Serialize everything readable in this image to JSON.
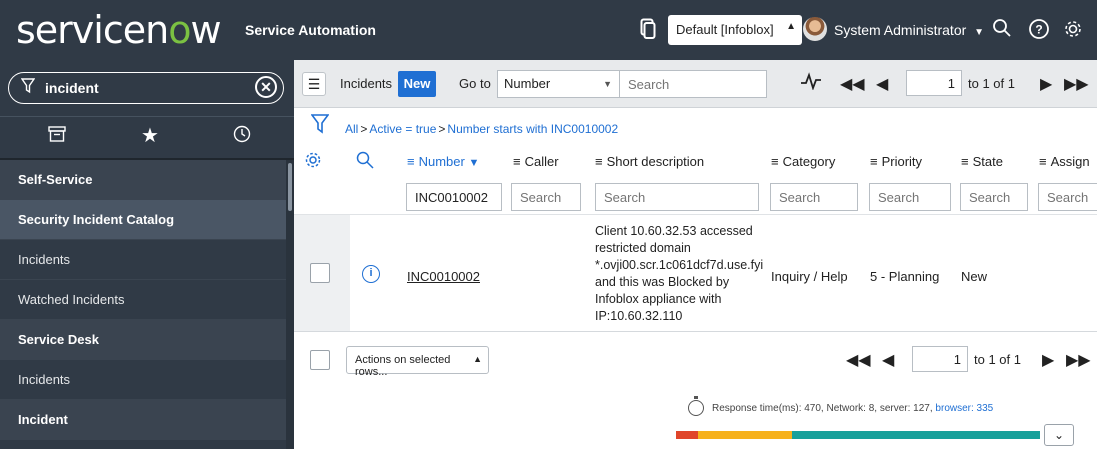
{
  "header": {
    "logo_part1": "servicen",
    "logo_part2": "o",
    "logo_part3": "w",
    "app_name": "Service Automation",
    "domain_value": "Default [Infoblox]",
    "username": "System Administrator",
    "icons": [
      "connect-icon",
      "search-icon",
      "help-icon",
      "gear-icon"
    ]
  },
  "nav": {
    "filter_value": "incident",
    "tabs": [
      "all-apps-icon",
      "favorites-star-icon",
      "history-clock-icon"
    ],
    "items": [
      {
        "label": "Self-Service",
        "kind": "section"
      },
      {
        "label": "Security Incident Catalog",
        "kind": "active"
      },
      {
        "label": "Incidents",
        "kind": "item"
      },
      {
        "label": "Watched Incidents",
        "kind": "item"
      },
      {
        "label": "Service Desk",
        "kind": "section"
      },
      {
        "label": "Incidents",
        "kind": "item"
      },
      {
        "label": "Incident",
        "kind": "section"
      }
    ]
  },
  "list": {
    "title": "Incidents",
    "new_label": "New",
    "goto_label": "Go to",
    "field_value": "Number",
    "search_placeholder": "Search",
    "page_value": "1",
    "page_text": "to 1 of 1"
  },
  "breadcrumb": [
    "All",
    "Active = true",
    "Number starts with INC0010002"
  ],
  "columns": [
    "Number",
    "Caller",
    "Short description",
    "Category",
    "Priority",
    "State",
    "Assign"
  ],
  "column_search": {
    "number": "INC0010002",
    "placeholder": "Search"
  },
  "rows": [
    {
      "number": "INC0010002",
      "caller": "",
      "short_description": "Client 10.60.32.53 accessed restricted domain *.ovji00.scr.1c061dcf7d.use.fyi and this was Blocked by Infoblox appliance with IP:10.60.32.110",
      "category": "Inquiry / Help",
      "priority": "5 - Planning",
      "state": "New"
    }
  ],
  "footer": {
    "actions_label": "Actions on selected rows...",
    "page_value": "1",
    "page_text": "to 1 of 1"
  },
  "response": {
    "text": "Response time(ms): 470, Network: 8, server: 127,",
    "browser_link": "browser: 335",
    "segments": [
      {
        "name": "network",
        "value": 8,
        "color": "#e0452a"
      },
      {
        "name": "server",
        "value": 127,
        "color": "#f6b11c"
      },
      {
        "name": "browser",
        "value": 335,
        "color": "#17a09a"
      }
    ]
  },
  "colors": {
    "header_bg": "#303a46",
    "accent": "#1f6fd3",
    "logo_accent": "#7bc142"
  }
}
